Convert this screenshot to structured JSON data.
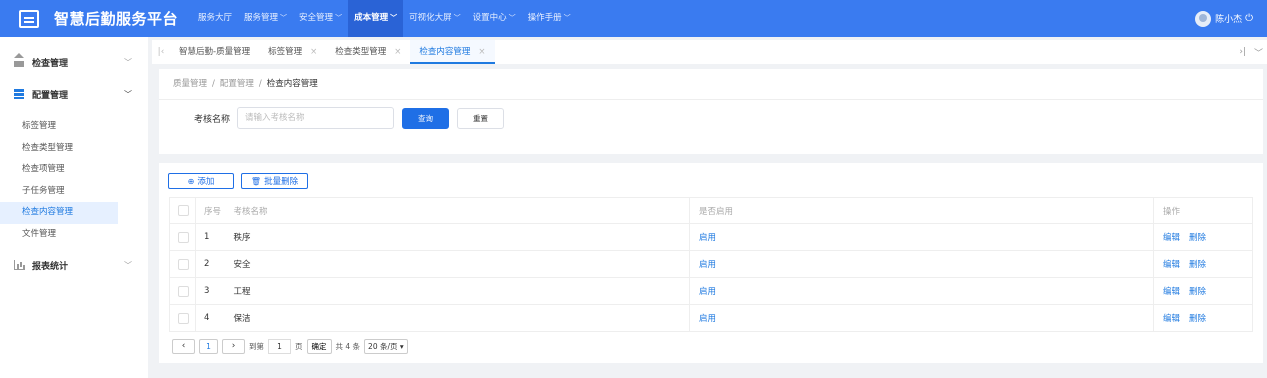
{
  "header": {
    "title": "智慧后勤服务平台",
    "nav": [
      {
        "label": "服务大厅",
        "dropdown": false,
        "active": false
      },
      {
        "label": "服务管理",
        "dropdown": true,
        "active": false
      },
      {
        "label": "安全管理",
        "dropdown": true,
        "active": false
      },
      {
        "label": "成本管理",
        "dropdown": true,
        "active": true
      },
      {
        "label": "可视化大屏",
        "dropdown": true,
        "active": false
      },
      {
        "label": "设置中心",
        "dropdown": true,
        "active": false
      },
      {
        "label": "操作手册",
        "dropdown": true,
        "active": false
      }
    ],
    "user_name": "陈小杰"
  },
  "sidebar": {
    "groups": [
      {
        "label": "检查管理",
        "icon": "home-icon",
        "expanded": false
      },
      {
        "label": "配置管理",
        "icon": "config-icon",
        "expanded": true
      },
      {
        "label": "报表统计",
        "icon": "chart-icon",
        "expanded": false
      }
    ],
    "items": [
      {
        "label": "标签管理",
        "active": false
      },
      {
        "label": "检查类型管理",
        "active": false
      },
      {
        "label": "检查项管理",
        "active": false
      },
      {
        "label": "子任务管理",
        "active": false
      },
      {
        "label": "检查内容管理",
        "active": true
      },
      {
        "label": "文件管理",
        "active": false
      }
    ]
  },
  "tabs": [
    {
      "label": "智慧后勤-质量管理",
      "closable": false,
      "active": false
    },
    {
      "label": "标签管理",
      "closable": true,
      "active": false
    },
    {
      "label": "检查类型管理",
      "closable": true,
      "active": false
    },
    {
      "label": "检查内容管理",
      "closable": true,
      "active": true
    }
  ],
  "breadcrumb": [
    "质量管理",
    "配置管理",
    "检查内容管理"
  ],
  "search": {
    "label": "考核名称",
    "placeholder": "请输入考核名称",
    "value": "",
    "query_label": "查询",
    "reset_label": "重置"
  },
  "toolbar": {
    "add_label": "添加",
    "batch_delete_label": "批量删除"
  },
  "table": {
    "columns": [
      "序号",
      "考核名称",
      "是否启用",
      "操作"
    ],
    "rows": [
      {
        "no": "1",
        "name": "秩序",
        "status": "启用"
      },
      {
        "no": "2",
        "name": "安全",
        "status": "启用"
      },
      {
        "no": "3",
        "name": "工程",
        "status": "启用"
      },
      {
        "no": "4",
        "name": "保洁",
        "status": "启用"
      }
    ],
    "edit_label": "编辑",
    "delete_label": "删除"
  },
  "pagination": {
    "current_page": "1",
    "goto_prefix": "到第",
    "goto_value": "1",
    "goto_suffix": "页",
    "confirm_label": "确定",
    "total_text": "共 4 条",
    "page_size": "20 条/页"
  },
  "colors": {
    "primary": "#3a7bf0",
    "active_nav": "#2a63d6",
    "link": "#1f7ae0"
  }
}
